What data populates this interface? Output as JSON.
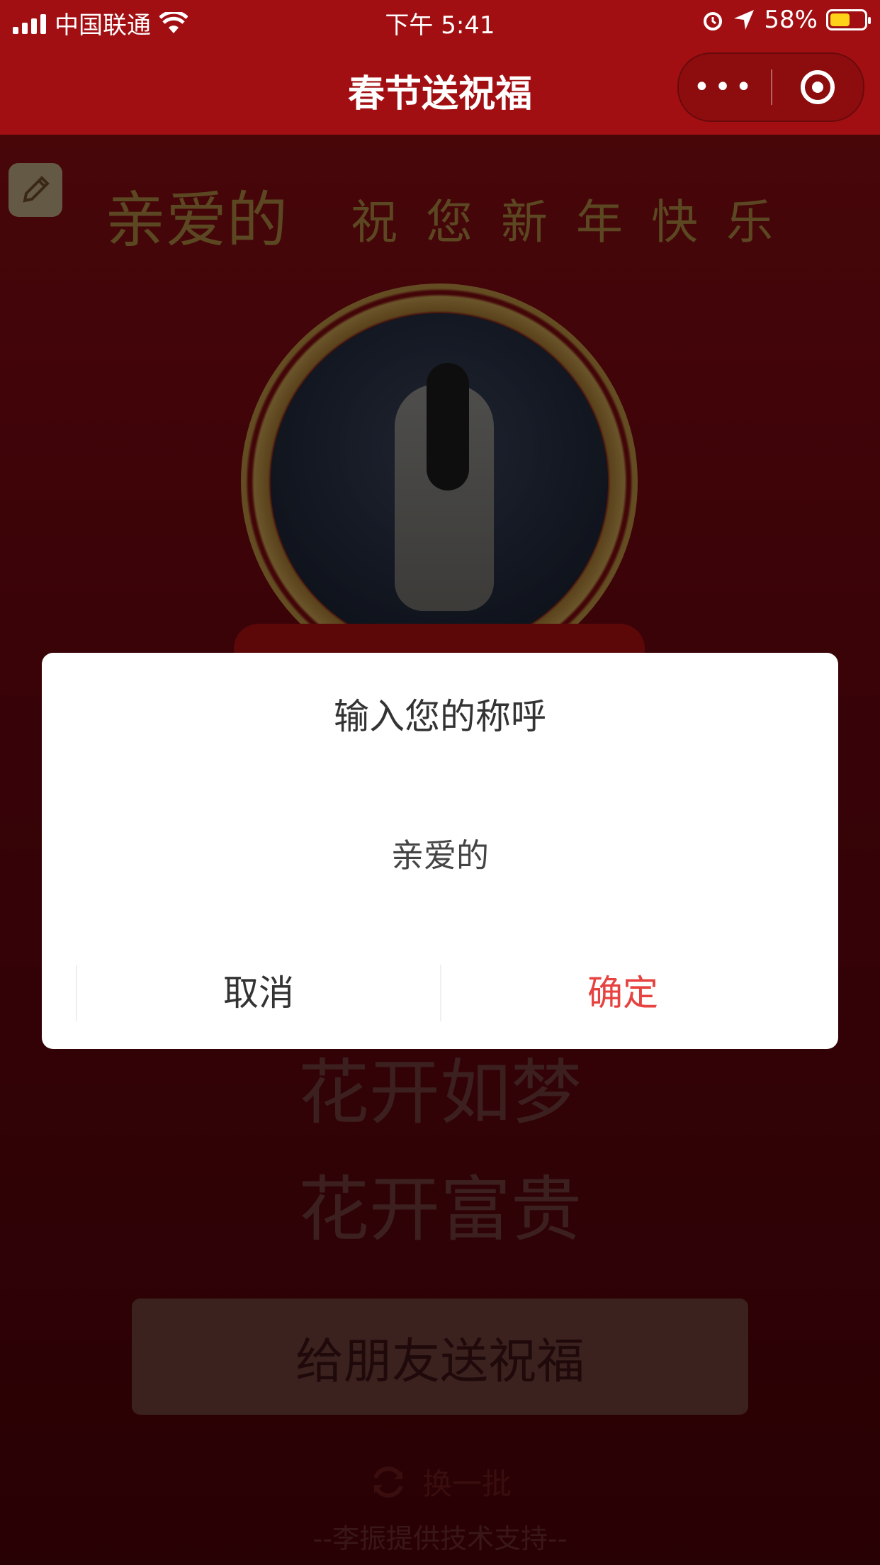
{
  "status_bar": {
    "carrier": "中国联通",
    "time": "下午 5:41",
    "battery_percent": "58%",
    "battery_level": 0.58,
    "icons": [
      "signal-icon",
      "wifi-icon",
      "alarm-icon",
      "location-arrow-icon",
      "battery-icon"
    ]
  },
  "nav": {
    "title": "春节送祝福",
    "more_label": "•••"
  },
  "greeting": {
    "name": "亲爱的",
    "wish": "祝您新年快乐"
  },
  "poem_lines": [
    "花开如梦",
    "花开富贵"
  ],
  "send_button": "给朋友送祝福",
  "refresh_label": "换一批",
  "footer": "--李振提供技术支持--",
  "dialog": {
    "title": "输入您的称呼",
    "input_value": "亲爱的",
    "cancel": "取消",
    "confirm": "确定"
  },
  "colors": {
    "nav_bg": "#a10f12",
    "gold_text": "#a6823e",
    "confirm": "#e64340"
  }
}
